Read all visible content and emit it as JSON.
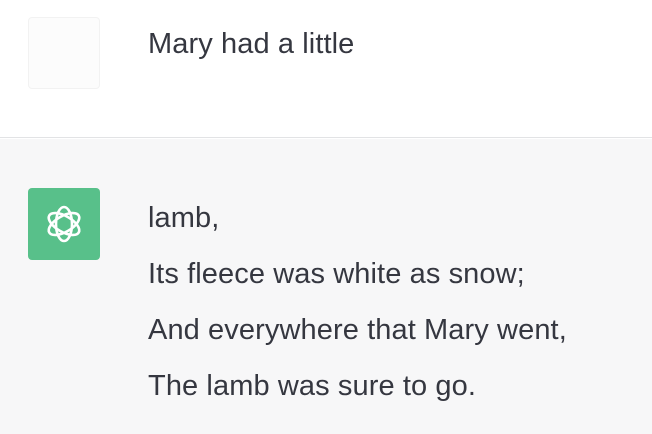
{
  "conversation": {
    "user_message": {
      "avatar": "user-avatar-placeholder",
      "text": "Mary had a little"
    },
    "assistant_message": {
      "avatar": "openai-logo-icon",
      "avatar_color": "#58c08a",
      "lines": [
        "lamb,",
        "Its fleece was white as snow;",
        "And everywhere that Mary went,",
        "The lamb was sure to go."
      ]
    }
  },
  "colors": {
    "text": "#353740",
    "assistant_bg": "#f7f7f8",
    "user_bg": "#ffffff",
    "divider": "#e2e3e5"
  }
}
